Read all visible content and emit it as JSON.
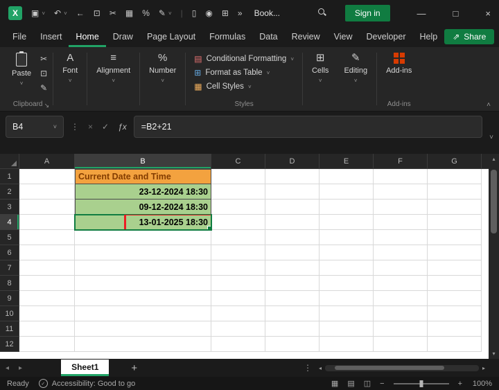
{
  "window": {
    "title": "Book...",
    "sign_in_label": "Sign in"
  },
  "glyphs": {
    "logo": "X",
    "save": "▣",
    "undo": "↶",
    "back": "←",
    "copy": "⊡",
    "cut": "✂",
    "chart": "▦",
    "percent": "%",
    "brush": "✎",
    "doc": "▯",
    "camera": "◉",
    "table": "⊞",
    "more": "»",
    "pipe": "|",
    "chevron_down": "˅",
    "chevron_up": "˄",
    "close": "×",
    "minimize": "—",
    "maximize": "□",
    "check": "✓",
    "fx": "ƒx",
    "ellipsis": "⋮",
    "left": "◂",
    "right": "▸",
    "up": "▴",
    "down": "▾",
    "minus": "−",
    "plus": "+",
    "font": "A",
    "align": "≡",
    "dialog": "↘",
    "share": "⇗",
    "cells": "⊞",
    "editing": "✎",
    "cond_fmt": "▤",
    "fmt_table": "⊞",
    "cell_styles": "▦",
    "view_normal": "▦",
    "view_layout": "▤",
    "view_break": "◫"
  },
  "menu": {
    "tabs": [
      "File",
      "Insert",
      "Home",
      "Draw",
      "Page Layout",
      "Formulas",
      "Data",
      "Review",
      "View",
      "Developer",
      "Help"
    ],
    "active_tab": "Home",
    "share_label": "Share"
  },
  "ribbon": {
    "paste_label": "Paste",
    "groups": {
      "clipboard": "Clipboard",
      "styles": "Styles",
      "addins": "Add-ins"
    },
    "buttons": {
      "font": "Font",
      "alignment": "Alignment",
      "number": "Number",
      "conditional_formatting": "Conditional Formatting",
      "format_as_table": "Format as Table",
      "cell_styles": "Cell Styles",
      "cells": "Cells",
      "editing": "Editing",
      "addins": "Add-ins"
    }
  },
  "formula_bar": {
    "name_box": "B4",
    "formula": "=B2+21"
  },
  "grid": {
    "column_headers": [
      "A",
      "B",
      "C",
      "D",
      "E",
      "F",
      "G"
    ],
    "row_headers": [
      "1",
      "2",
      "3",
      "4",
      "5",
      "6",
      "7",
      "8",
      "9",
      "10",
      "11",
      "12"
    ],
    "selected_column": "B",
    "selected_row": "4",
    "selected_cell": "B4",
    "cells": [
      {
        "ref": "B1",
        "text": "Current Date and Time",
        "style": "orange-header"
      },
      {
        "ref": "B2",
        "text": "23-12-2024 18:30",
        "style": "green"
      },
      {
        "ref": "B3",
        "text": "09-12-2024 18:30",
        "style": "green"
      },
      {
        "ref": "B4",
        "text": "13-01-2025 18:30",
        "style": "green selected highlighted"
      }
    ]
  },
  "sheet_bar": {
    "tabs": [
      {
        "label": "Sheet1",
        "active": true
      }
    ]
  },
  "status_bar": {
    "ready": "Ready",
    "accessibility": "Accessibility: Good to go",
    "zoom": "100%"
  },
  "colors": {
    "excel_green": "#21A366",
    "accent_green": "#107C41",
    "orange_fill": "#F3A23F",
    "orange_text": "#833C00",
    "green_fill": "#A9D08E",
    "red_highlight": "#ED1C24",
    "addin_orange": "#D83B01"
  }
}
